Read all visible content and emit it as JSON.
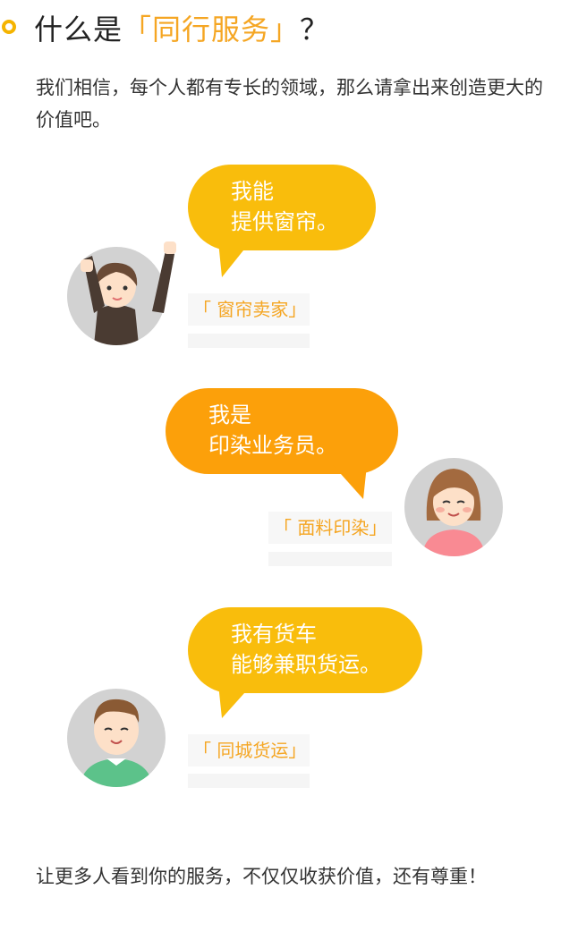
{
  "header": {
    "title_prefix": "什么是",
    "title_highlight": "「同行服务」",
    "title_suffix": "？"
  },
  "intro": "我们相信，每个人都有专长的领域，那么请拿出来创造更大的价值吧。",
  "cards": [
    {
      "line1": "我能",
      "line2": "提供窗帘。",
      "tag": "「 窗帘卖家」",
      "bubble_color": "#f9bd0c"
    },
    {
      "line1": "我是",
      "line2": "印染业务员。",
      "tag": "「 面料印染」",
      "bubble_color": "#fca00a"
    },
    {
      "line1": "我有货车",
      "line2": "能够兼职货运。",
      "tag": "「 同城货运」",
      "bubble_color": "#f9bd0c"
    }
  ],
  "outro": "让更多人看到你的服务，不仅仅收获价值，还有尊重！",
  "colors": {
    "accent": "#f5a623",
    "bubble_yellow": "#f9bd0c",
    "bubble_orange": "#fca00a",
    "avatar_bg": "#d2d2d2"
  }
}
